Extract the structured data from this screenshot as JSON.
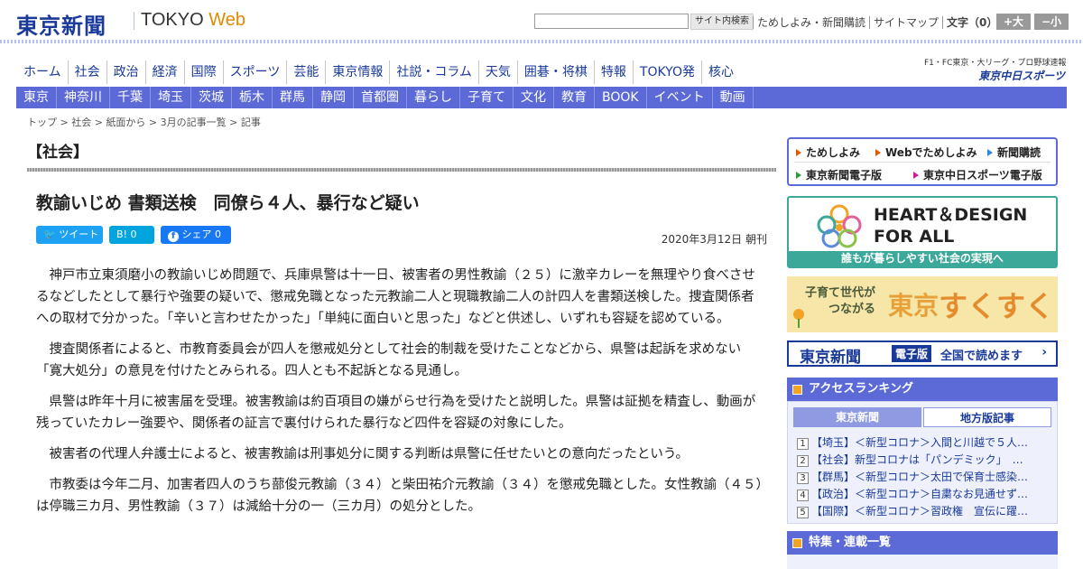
{
  "header": {
    "logo": "東京新聞",
    "logo_sub_prefix": "TOKYO ",
    "logo_sub_web": "Web",
    "search_value": "",
    "search_button": "サイト内検索",
    "links": [
      "ためしよみ・新聞購読",
      "サイトマップ"
    ],
    "font_size_label": "文字（0）",
    "font_bigger": "+大",
    "font_smaller": "−小"
  },
  "main_nav": [
    "ホーム",
    "社会",
    "政治",
    "経済",
    "国際",
    "スポーツ",
    "芸能",
    "東京情報",
    "社説・コラム",
    "天気",
    "囲碁・将棋",
    "特報",
    "TOKYO発",
    "核心"
  ],
  "chunichi": {
    "line1": "F1・FC東京・大リーグ・プロ野球速報",
    "line2": "東京中日スポーツ"
  },
  "region_nav": [
    "東京",
    "神奈川",
    "千葉",
    "埼玉",
    "茨城",
    "栃木",
    "群馬",
    "静岡",
    "首都圏",
    "暮らし",
    "子育て",
    "文化",
    "教育",
    "BOOK",
    "イベント",
    "動画"
  ],
  "breadcrumb": [
    "トップ",
    "社会",
    "紙面から",
    "3月の記事一覧",
    "記事"
  ],
  "article": {
    "section": "【社会】",
    "headline": "教諭いじめ 書類送検　同僚ら４人、暴行など疑い",
    "share": {
      "tweet": "ツイート",
      "hatena": "B! 0",
      "facebook": "シェア 0"
    },
    "date": "2020年3月12日 朝刊",
    "paragraphs": [
      "神戸市立東須磨小の教諭いじめ問題で、兵庫県警は十一日、被害者の男性教諭（２５）に激辛カレーを無理やり食べさせるなどしたとして暴行や強要の疑いで、懲戒免職となった元教諭二人と現職教諭二人の計四人を書類送検した。捜査関係者への取材で分かった。「辛いと言わせたかった」「単純に面白いと思った」などと供述し、いずれも容疑を認めている。",
      "捜査関係者によると、市教育委員会が四人を懲戒処分として社会的制裁を受けたことなどから、県警は起訴を求めない「寛大処分」の意見を付けたとみられる。四人とも不起訴となる見通し。",
      "県警は昨年十月に被害届を受理。被害教諭は約百項目の嫌がらせ行為を受けたと説明した。県警は証拠を精査し、動画が残っていたカレー強要や、関係者の証言で裏付けられた暴行など四件を容疑の対象にした。",
      "被害者の代理人弁護士によると、被害教諭は刑事処分に関する判断は県警に任せたいとの意向だったという。",
      "市教委は今年二月、加害者四人のうち蔀俊元教諭（３４）と柴田祐介元教諭（３４）を懲戒免職とした。女性教諭（４５）は停職三カ月、男性教諭（３７）は減給十分の一（三カ月）の処分とした。"
    ]
  },
  "sidebar": {
    "quicklinks": [
      {
        "label": "ためしよみ",
        "color": "#e05a00"
      },
      {
        "label": "Webでためしよみ",
        "color": "#e05a00"
      },
      {
        "label": "新聞購読",
        "color": "#2a8adc"
      },
      {
        "label": "東京新聞電子版",
        "color": "#2a9a3a"
      },
      {
        "label": "東京中日スポーツ電子版",
        "color": "#d01a9a"
      }
    ],
    "heart_design": {
      "line1": "HEART＆DESIGN",
      "line2": "FOR ALL",
      "footer": "誰もが暮らしやすい社会の実現へ"
    },
    "sukusuku": {
      "line1": "子育て世代が",
      "line2": "つながる",
      "brand1": "東京",
      "brand2": "すくすく"
    },
    "denshiban": {
      "brand": "東京新聞",
      "tag": "電子版",
      "text": "全国で読めます",
      "arrow": "›"
    },
    "ranking": {
      "title": "アクセスランキング",
      "tabs": [
        "東京新聞",
        "地方版記事"
      ],
      "items": [
        {
          "n": "1",
          "text": "【埼玉】＜新型コロナ＞入間と川越で５人…"
        },
        {
          "n": "2",
          "text": "【社会】新型コロナは「パンデミック」　…"
        },
        {
          "n": "3",
          "text": "【群馬】＜新型コロナ＞太田で保育士感染…"
        },
        {
          "n": "4",
          "text": "【政治】＜新型コロナ＞自粛なお見通せず…"
        },
        {
          "n": "5",
          "text": "【国際】＜新型コロナ＞習政権　宣伝に躍…"
        }
      ]
    },
    "features": {
      "title": "特集・連載一覧"
    }
  }
}
